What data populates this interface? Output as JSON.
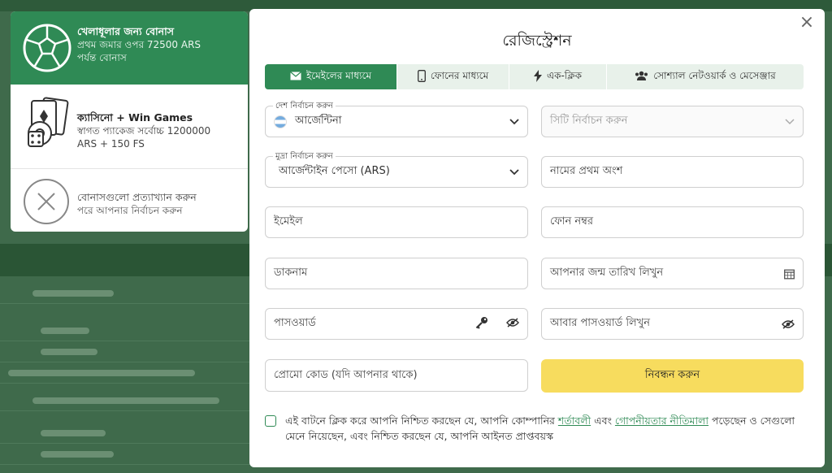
{
  "bonus_panel": {
    "sports": {
      "title": "খেলাধূলার জন্য বোনাস",
      "line1": "প্রথম জমার ওপর 72500 ARS",
      "line2": "পর্যন্ত বোনাস",
      "icon": "soccer-ball-icon"
    },
    "casino": {
      "title": "ক্যাসিনো + Win Games",
      "line1": "স্বাগত প্যাকেজ সর্বোচ্চ 1200000",
      "line2": "ARS + 150 FS",
      "icon": "cards-dice-icon"
    },
    "decline": {
      "title": "বোনাসগুলো প্রত্যাখ্যান করুন",
      "line1": "পরে আপনার নির্বাচন করুন",
      "icon": "x-circle-icon"
    }
  },
  "modal": {
    "title": "রেজিস্ট্রেশন",
    "close_icon": "close-icon",
    "tabs": [
      {
        "label": "ইমেইলের মাধ্যমে",
        "icon": "envelope-icon",
        "active": true
      },
      {
        "label": "ফোনের মাধ্যমে",
        "icon": "phone-icon",
        "active": false
      },
      {
        "label": "এক-ক্লিক",
        "icon": "lightning-icon",
        "active": false
      },
      {
        "label": "সোশ্যাল নেটওয়ার্ক ও মেসেঞ্জার",
        "icon": "users-icon",
        "active": false
      }
    ],
    "form": {
      "country_label": "দেশ নির্বাচন করুন",
      "country_value": "আর্জেন্টিনা",
      "city_placeholder": "সিটি নির্বাচন করুন",
      "currency_label": "মুদ্রা নির্বাচন করুন",
      "currency_value": "আর্জেন্টাইন পেসো (ARS)",
      "first_name_placeholder": "নামের প্রথম অংশ",
      "email_placeholder": "ইমেইল",
      "phone_placeholder": "ফোন নম্বর",
      "nickname_placeholder": "ডাকনাম",
      "birthdate_placeholder": "আপনার জন্ম তারিখ লিখুন",
      "password_placeholder": "পাসওয়ার্ড",
      "repeat_password_placeholder": "আবার পাসওয়ার্ড লিখুন",
      "promo_placeholder": "প্রোমো কোড (যদি আপনার থাকে)",
      "submit_label": "নিবন্ধন করুন"
    },
    "consent": {
      "text_before": "এই বাটনে ক্লিক করে আপনি নিশ্চিত করছেন যে, আপনি কোম্পানির ",
      "terms_link": "শর্তাবলী",
      "text_middle": " এবং ",
      "privacy_link": "গোপনীয়তার নীতিমালা",
      "text_after": " পড়েছেন ও সেগুলো মেনে নিয়েছেন, এবং নিশ্চিত করছেন যে, আপনি আইনত প্রাপ্তবয়স্ক"
    }
  },
  "colors": {
    "accent_green": "#2f8a55",
    "submit_yellow": "#f7dc5e",
    "overlay": "#3f6a4b"
  }
}
